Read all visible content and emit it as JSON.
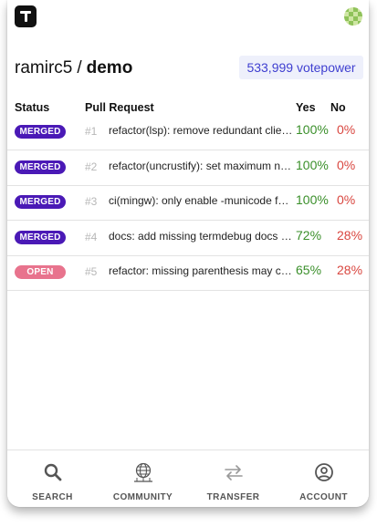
{
  "repo": {
    "owner": "ramirc5",
    "separator": "/",
    "name": "demo"
  },
  "votepower": "533,999 votepower",
  "table": {
    "headers": {
      "status": "Status",
      "pull_request": "Pull Request",
      "yes": "Yes",
      "no": "No"
    },
    "rows": [
      {
        "status": "MERGED",
        "number": "#1",
        "title": "refactor(lsp): remove redundant clie…",
        "yes": "100%",
        "no": "0%"
      },
      {
        "status": "MERGED",
        "number": "#2",
        "title": "refactor(uncrustify): set maximum n…",
        "yes": "100%",
        "no": "0%"
      },
      {
        "status": "MERGED",
        "number": "#3",
        "title": "ci(mingw): only enable -municode f…",
        "yes": "100%",
        "no": "0%"
      },
      {
        "status": "MERGED",
        "number": "#4",
        "title": "docs: add missing termdebug docs …",
        "yes": "72%",
        "no": "28%"
      },
      {
        "status": "OPEN",
        "number": "#5",
        "title": "refactor: missing parenthesis may c…",
        "yes": "65%",
        "no": "28%"
      }
    ]
  },
  "nav": {
    "items": [
      {
        "label": "SEARCH",
        "icon": "search-icon"
      },
      {
        "label": "COMMUNITY",
        "icon": "community-icon"
      },
      {
        "label": "TRANSFER",
        "icon": "transfer-icon"
      },
      {
        "label": "ACCOUNT",
        "icon": "account-icon"
      }
    ]
  },
  "colors": {
    "merged": "#4a19b6",
    "open": "#e8738d",
    "yes": "#3a8f2a",
    "no": "#d9463f",
    "votepower_text": "#3f3fd0",
    "votepower_bg": "#eef0fb"
  }
}
